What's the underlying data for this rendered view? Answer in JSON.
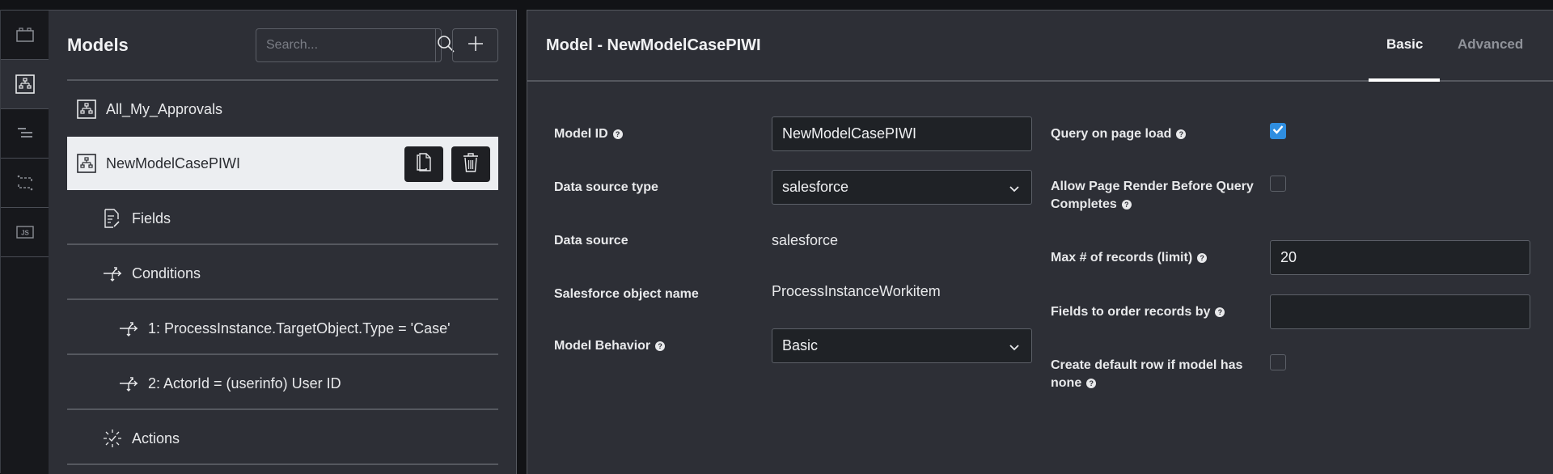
{
  "rail": {
    "items": [
      {
        "name": "components",
        "icon": "block-icon"
      },
      {
        "name": "models",
        "icon": "model-icon",
        "active": true
      },
      {
        "name": "outline",
        "icon": "outline-icon"
      },
      {
        "name": "interactions",
        "icon": "interactions-icon"
      },
      {
        "name": "javascript",
        "icon": "js-icon",
        "label": "JS"
      }
    ]
  },
  "left_panel": {
    "title": "Models",
    "search_placeholder": "Search...",
    "search_value": "",
    "items": [
      {
        "label": "All_My_Approvals",
        "icon": "model-icon",
        "level": 0
      },
      {
        "label": "NewModelCasePIWI",
        "icon": "model-icon",
        "level": 0,
        "selected": true
      },
      {
        "label": "Fields",
        "icon": "fields-icon",
        "level": 1
      },
      {
        "label": "Conditions",
        "icon": "conditions-icon",
        "level": 1
      },
      {
        "label": "1: ProcessInstance.TargetObject.Type = 'Case'",
        "icon": "condition-icon",
        "level": 2
      },
      {
        "label": "2: ActorId = (userinfo) User ID",
        "icon": "condition-icon",
        "level": 2
      },
      {
        "label": "Actions",
        "icon": "actions-icon",
        "level": 1
      }
    ]
  },
  "right_panel": {
    "title": "Model - NewModelCasePIWI",
    "tabs": [
      {
        "label": "Basic",
        "active": true
      },
      {
        "label": "Advanced",
        "active": false
      }
    ],
    "fields_left": {
      "model_id": {
        "label": "Model ID",
        "value": "NewModelCasePIWI",
        "help": true
      },
      "data_source_type": {
        "label": "Data source type",
        "value": "salesforce"
      },
      "data_source": {
        "label": "Data source",
        "value": "salesforce"
      },
      "sf_object_name": {
        "label": "Salesforce object name",
        "value": "ProcessInstanceWorkitem"
      },
      "model_behavior": {
        "label": "Model Behavior",
        "value": "Basic",
        "help": true
      }
    },
    "fields_right": {
      "query_on_load": {
        "label": "Query on page load",
        "checked": true,
        "help": true
      },
      "allow_render": {
        "label_1": "Allow Page Render Before Query",
        "label_2": "Completes",
        "checked": false,
        "help": true
      },
      "max_records": {
        "label": "Max # of records (limit)",
        "value": "20",
        "help": true
      },
      "order_fields": {
        "label": "Fields to order records by",
        "value": "",
        "help": true
      },
      "default_row": {
        "label_1": "Create default row if model has",
        "label_2": "none",
        "checked": false,
        "help": true
      }
    }
  },
  "colors": {
    "panel_bg": "#2d2f36",
    "rail_bg": "#17181c",
    "selected_bg": "#eceef1",
    "accent": "#2f8ee0"
  }
}
